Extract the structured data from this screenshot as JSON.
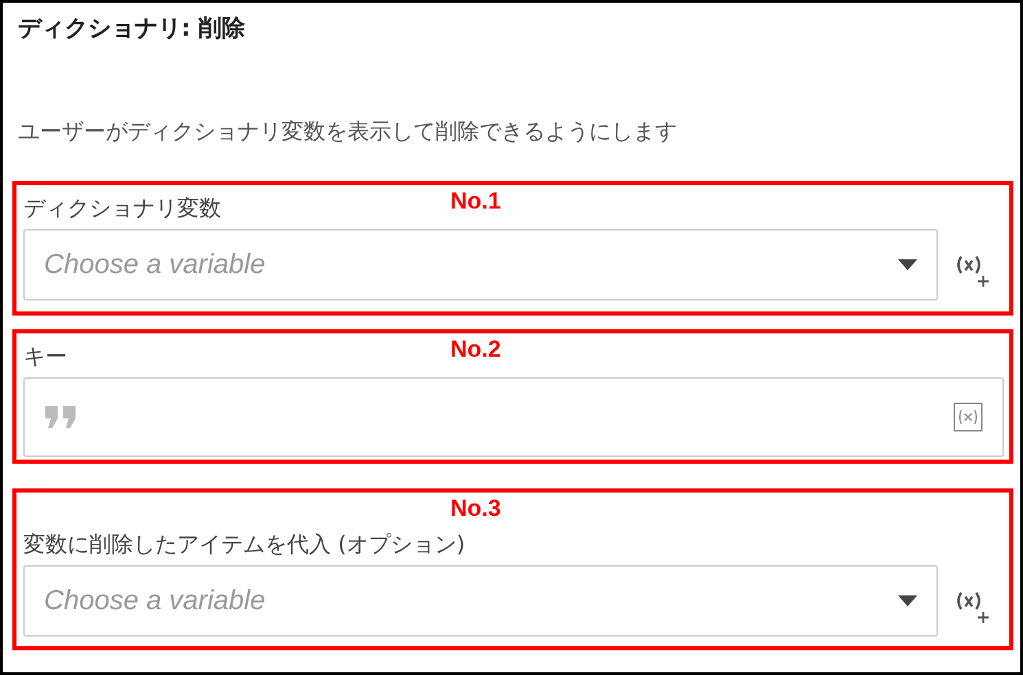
{
  "title": "ディクショナリ: 削除",
  "description": "ユーザーがディクショナリ変数を表示して削除できるようにします",
  "fields": [
    {
      "kind": "select",
      "annotation": "No.1",
      "label": "ディクショナリ変数",
      "placeholder": "Choose a variable"
    },
    {
      "kind": "text",
      "annotation": "No.2",
      "label": "キー"
    },
    {
      "kind": "select",
      "annotation": "No.3",
      "label": "変数に削除したアイテムを代入 (オプション)",
      "placeholder": "Choose a variable"
    }
  ]
}
